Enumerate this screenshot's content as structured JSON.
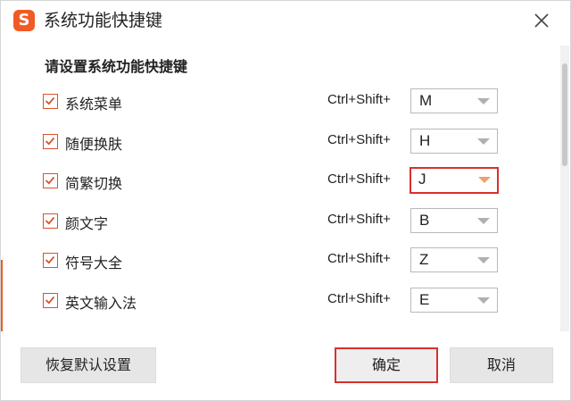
{
  "window": {
    "title": "系统功能快捷键",
    "logo_glyph": "S",
    "accent_color": "#f15a24"
  },
  "section_title": "请设置系统功能快捷键",
  "shortcuts": [
    {
      "label": "系统菜单",
      "checked": true,
      "prefix": "Ctrl+Shift+",
      "key": "M",
      "highlighted": false
    },
    {
      "label": "随便换肤",
      "checked": true,
      "prefix": "Ctrl+Shift+",
      "key": "H",
      "highlighted": false
    },
    {
      "label": "简繁切换",
      "checked": true,
      "prefix": "Ctrl+Shift+",
      "key": "J",
      "highlighted": true
    },
    {
      "label": "颜文字",
      "checked": true,
      "prefix": "Ctrl+Shift+",
      "key": "B",
      "highlighted": false
    },
    {
      "label": "符号大全",
      "checked": true,
      "prefix": "Ctrl+Shift+",
      "key": "Z",
      "highlighted": false
    },
    {
      "label": "英文输入法",
      "checked": true,
      "prefix": "Ctrl+Shift+",
      "key": "E",
      "highlighted": false
    }
  ],
  "buttons": {
    "restore": "恢复默认设置",
    "ok": "确定",
    "cancel": "取消"
  },
  "icons": {
    "close": "close-icon",
    "check": "checkmark-icon",
    "dropdown": "chevron-down-icon",
    "logo": "sogou-logo-icon"
  },
  "colors": {
    "check": "#d9532b",
    "highlight_border": "#d9302a"
  }
}
